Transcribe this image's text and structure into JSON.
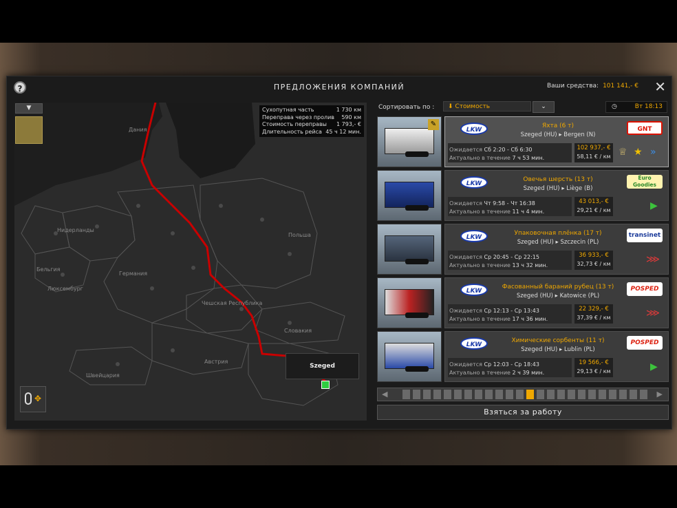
{
  "window": {
    "title": "ПРЕДЛОЖЕНИЯ КОМПАНИЙ",
    "help_icon": "question-icon",
    "close_icon": "close-icon"
  },
  "funds": {
    "label": "Ваши средства:",
    "value": "101 141,- €"
  },
  "route_info": {
    "rows": [
      {
        "label": "Сухопутная часть",
        "value": "1 730 км"
      },
      {
        "label": "Переправа через пролив",
        "value": "590 км"
      },
      {
        "label": "Стоимость переправы",
        "value": "1 793,- €"
      },
      {
        "label": "Длительность рейса",
        "value": "45 ч 12 мин."
      }
    ]
  },
  "map": {
    "countries": [
      "Дания",
      "Нидерланды",
      "Бельгия",
      "Люксембург",
      "Германия",
      "Польша",
      "Чешская Республика",
      "Словакия",
      "Австрия",
      "Швейцария"
    ],
    "tooltip_city": "Szeged",
    "route_color": "#c80000"
  },
  "sort": {
    "label": "Сортировать по :",
    "value": "Стоимость",
    "icon": "arrow-down-icon"
  },
  "clock": {
    "icon": "clock-icon",
    "value": "Вт 18:13"
  },
  "offers": [
    {
      "company_logo": "LKW",
      "cargo": "Яхта (6 т)",
      "from": "Szeged (HU)",
      "to": "Bergen (N)",
      "client_logo": "GNT",
      "wait_label": "Ожидается",
      "wait": "Сб 2:20 - Сб 6:30",
      "valid_label": "Актуально в течение",
      "valid": "7 ч 53 мин.",
      "price": "102 937,- €",
      "per_km": "58,11 € / км",
      "actions": [
        "trophy-icon",
        "star-icon",
        "double-arrow-icon"
      ]
    },
    {
      "company_logo": "LKW",
      "cargo": "Овечья шерсть (13 т)",
      "from": "Szeged (HU)",
      "to": "Liège (B)",
      "client_logo": "Euro Goodies",
      "wait_label": "Ожидается",
      "wait": "Чт 9:58 - Чт 16:38",
      "valid_label": "Актуально в течение",
      "valid": "11 ч 4 мин.",
      "price": "43 013,- €",
      "per_km": "29,21 € / км",
      "actions": [
        "play-icon"
      ]
    },
    {
      "company_logo": "LKW",
      "cargo": "Упаковочная плёнка (17 т)",
      "from": "Szeged (HU)",
      "to": "Szczecin (PL)",
      "client_logo": "transinet",
      "wait_label": "Ожидается",
      "wait": "Ср 20:45 - Ср 22:15",
      "valid_label": "Актуально в течение",
      "valid": "13 ч 32 мин.",
      "price": "36 933,- €",
      "per_km": "32,73 € / км",
      "actions": [
        "triple-arrow-icon"
      ]
    },
    {
      "company_logo": "LKW",
      "cargo": "Фасованный бараний рубец (13 т)",
      "from": "Szeged (HU)",
      "to": "Katowice (PL)",
      "client_logo": "POSPED",
      "wait_label": "Ожидается",
      "wait": "Ср 12:13 - Ср 13:43",
      "valid_label": "Актуально в течение",
      "valid": "17 ч 36 мин.",
      "price": "22 329,- €",
      "per_km": "37,39 € / км",
      "actions": [
        "triple-arrow-icon"
      ]
    },
    {
      "company_logo": "LKW",
      "cargo": "Химические сорбенты (11 т)",
      "from": "Szeged (HU)",
      "to": "Lublin (PL)",
      "client_logo": "POSPED",
      "wait_label": "Ожидается",
      "wait": "Ср 12:03 - Ср 18:43",
      "valid_label": "Актуально в течение",
      "valid": "2 ч 39 мин.",
      "price": "19 566,- €",
      "per_km": "29,13 € / км",
      "actions": [
        "play-icon"
      ]
    }
  ],
  "take_job_label": "Взяться за работу"
}
